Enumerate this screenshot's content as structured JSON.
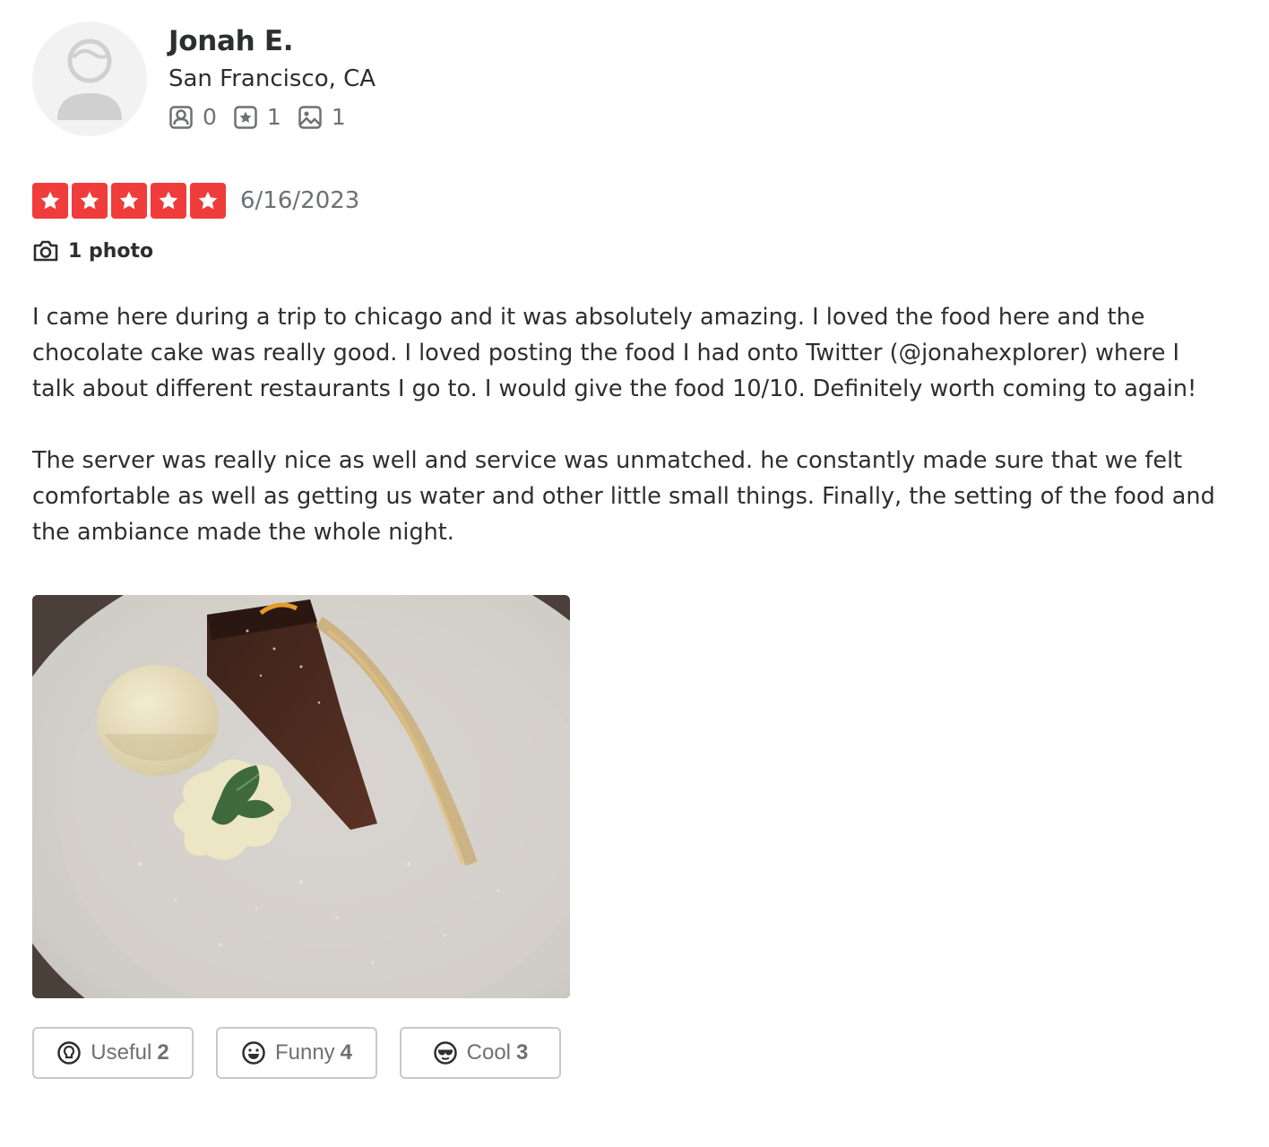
{
  "user": {
    "name": "Jonah E.",
    "location": "San Francisco, CA",
    "stats": {
      "friends": "0",
      "reviews": "1",
      "photos": "1"
    }
  },
  "review": {
    "rating": 5,
    "date": "6/16/2023",
    "photo_count_label": "1 photo",
    "paragraphs": [
      "I came here during a trip to chicago and it was absolutely amazing. I loved the food here and the chocolate cake was really good. I loved posting the food I had onto Twitter (@jonahexplorer) where I talk about different restaurants I go to. I would give the food 10/10. Definitely worth coming to again!",
      "The server was really nice as well and service was unmatched. he constantly made sure that we felt comfortable as well as getting us water and other little small things. Finally, the setting of the food and the ambiance made the whole night."
    ]
  },
  "reactions": {
    "useful": {
      "label": "Useful",
      "count": "2"
    },
    "funny": {
      "label": "Funny",
      "count": "4"
    },
    "cool": {
      "label": "Cool",
      "count": "3"
    }
  },
  "colors": {
    "star_red": "#f03c3a",
    "text": "#2d2e2f",
    "muted": "#6e7072"
  }
}
